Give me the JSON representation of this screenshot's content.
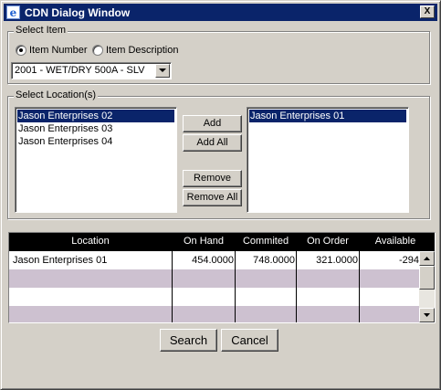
{
  "window": {
    "title": "CDN Dialog Window",
    "close_label": "X"
  },
  "select_item": {
    "legend": "Select Item",
    "radio_item_number": "Item Number",
    "radio_item_description": "Item Description",
    "selected_radio": "item_number",
    "combo_value": "2001 - WET/DRY 500A - SLV"
  },
  "select_location": {
    "legend": "Select Location(s)",
    "available": [
      "Jason Enterprises 02",
      "Jason Enterprises 03",
      "Jason Enterprises 04"
    ],
    "selected": [
      "Jason Enterprises 01"
    ],
    "add_label": "Add",
    "add_all_label": "Add All",
    "remove_label": "Remove",
    "remove_all_label": "Remove All"
  },
  "grid": {
    "columns": [
      "Location",
      "On Hand",
      "Commited",
      "On Order",
      "Available"
    ],
    "rows": [
      [
        "Jason Enterprises 01",
        "454.0000",
        "748.0000",
        "321.0000",
        "-294"
      ]
    ]
  },
  "footer": {
    "search_label": "Search",
    "cancel_label": "Cancel"
  },
  "colors": {
    "titlebar": "#0a246a",
    "selection": "#0a246a",
    "alt_row": "#cdc1d0",
    "grid_header": "#000000"
  }
}
